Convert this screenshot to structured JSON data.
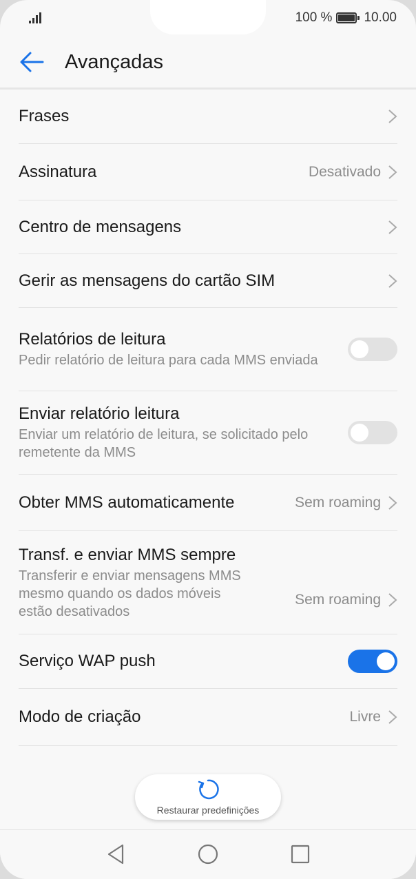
{
  "status_bar": {
    "battery_text": "100 %",
    "time": "10.00",
    "icons": [
      "signal-icon",
      "battery-icon"
    ]
  },
  "header": {
    "title": "Avançadas",
    "back_icon": "arrow-left-icon",
    "accent_color": "#1a73e8"
  },
  "settings": {
    "phrases": {
      "label": "Frases"
    },
    "signature": {
      "label": "Assinatura",
      "value": "Desativado"
    },
    "message_center": {
      "label": "Centro de mensagens"
    },
    "sim_messages": {
      "label": "Gerir as mensagens do cartão SIM"
    },
    "read_reports": {
      "label": "Relatórios de leitura",
      "sub": "Pedir relatório de leitura para cada MMS enviada",
      "enabled": false
    },
    "send_read_report": {
      "label": "Enviar relatório leitura",
      "sub": "Enviar um relatório de leitura, se solicitado pelo remetente da MMS",
      "enabled": false
    },
    "auto_mms": {
      "label": "Obter MMS automaticamente",
      "value": "Sem roaming"
    },
    "always_mms": {
      "label": "Transf. e enviar MMS sempre",
      "sub": "Transferir e enviar mensagens MMS mesmo quando os dados móveis estão desativados",
      "value": "Sem roaming"
    },
    "wap_push": {
      "label": "Serviço WAP push",
      "enabled": true
    },
    "creation_mode": {
      "label": "Modo de criação",
      "value": "Livre"
    }
  },
  "restore": {
    "label": "Restaurar predefinições",
    "icon": "restore-icon"
  },
  "nav_bar": {
    "icons": [
      "back-triangle-icon",
      "home-circle-icon",
      "recents-square-icon"
    ]
  }
}
